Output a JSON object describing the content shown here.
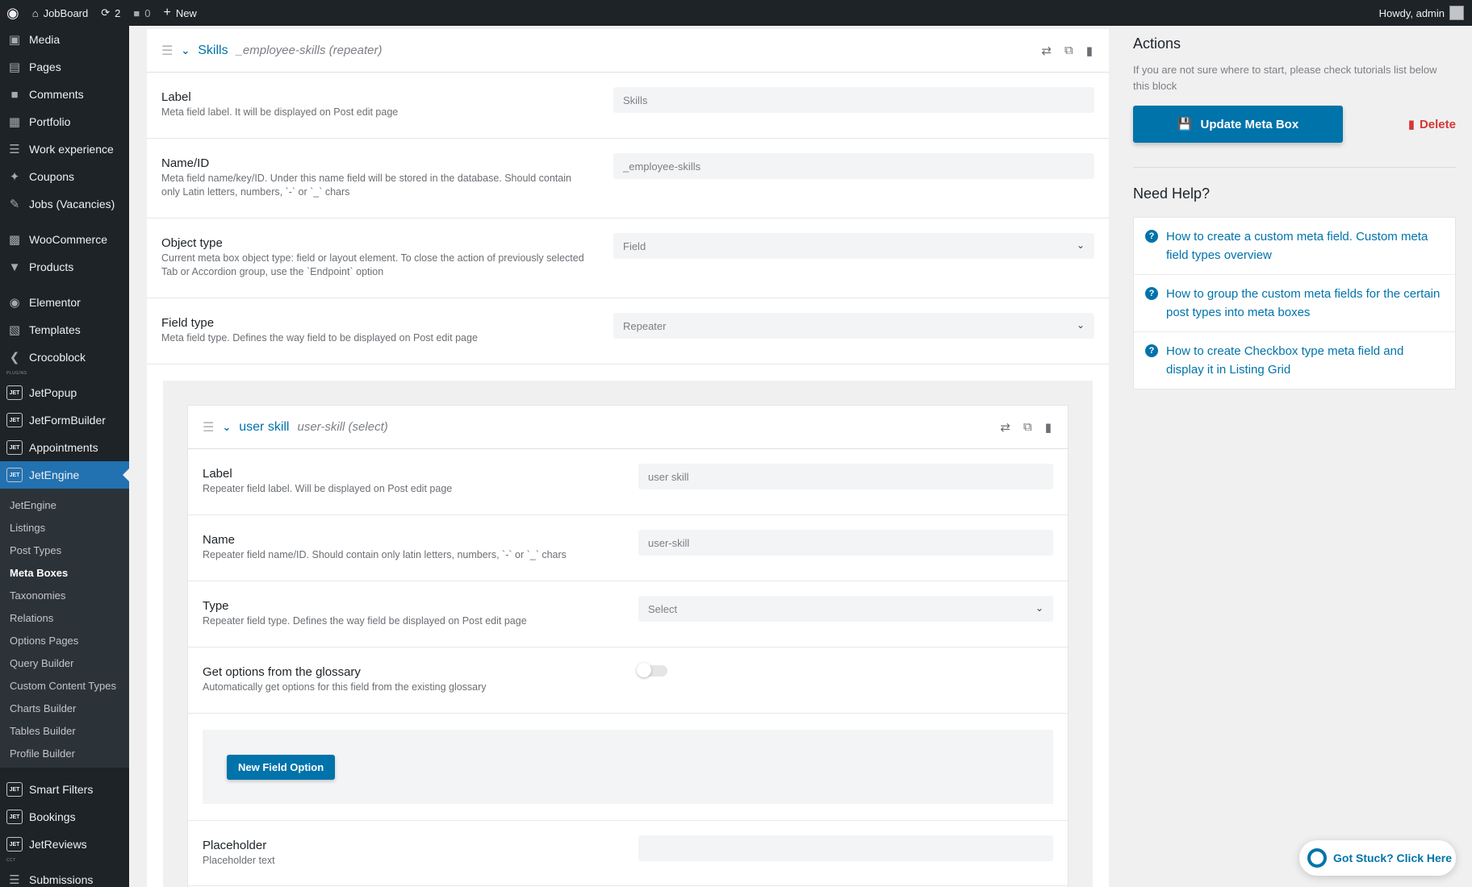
{
  "adminbar": {
    "site": "JobBoard",
    "updates": "2",
    "comments": "0",
    "new": "New",
    "howdy": "Howdy, admin"
  },
  "sidebar": {
    "top_items": [
      {
        "label": "Media",
        "icon": "media-icon"
      },
      {
        "label": "Pages",
        "icon": "pages-icon"
      },
      {
        "label": "Comments",
        "icon": "comments-icon"
      },
      {
        "label": "Portfolio",
        "icon": "portfolio-icon"
      },
      {
        "label": "Work experience",
        "icon": "list-icon"
      },
      {
        "label": "Coupons",
        "icon": "pin-icon"
      },
      {
        "label": "Jobs (Vacancies)",
        "icon": "edit-icon"
      }
    ],
    "woo_items": [
      {
        "label": "WooCommerce",
        "icon": "woo-icon"
      },
      {
        "label": "Products",
        "icon": "products-icon"
      }
    ],
    "builder_items": [
      {
        "label": "Elementor",
        "icon": "elementor-icon"
      },
      {
        "label": "Templates",
        "icon": "folder-icon"
      },
      {
        "label": "Crocoblock",
        "icon": "crocoblock-icon"
      }
    ],
    "plugins_tag": "PLUGINS",
    "jet_items": [
      {
        "label": "JetPopup"
      },
      {
        "label": "JetFormBuilder"
      },
      {
        "label": "Appointments"
      }
    ],
    "active_item": "JetEngine",
    "submenu": [
      "JetEngine",
      "Listings",
      "Post Types",
      "Meta Boxes",
      "Taxonomies",
      "Relations",
      "Options Pages",
      "Query Builder",
      "Custom Content Types",
      "Charts Builder",
      "Tables Builder",
      "Profile Builder"
    ],
    "submenu_current": "Meta Boxes",
    "bottom_items": [
      {
        "label": "Smart Filters"
      },
      {
        "label": "Bookings"
      },
      {
        "label": "JetReviews"
      }
    ],
    "cct_tag": "CCT",
    "cut_item": "Submissions"
  },
  "field": {
    "title": "Skills",
    "subtitle": "_employee-skills (repeater)",
    "rows": [
      {
        "label": "Label",
        "desc": "Meta field label. It will be displayed on Post edit page",
        "value": "Skills",
        "dropdown": false
      },
      {
        "label": "Name/ID",
        "desc": "Meta field name/key/ID. Under this name field will be stored in the database. Should contain only Latin letters, numbers, `-` or `_` chars",
        "value": "_employee-skills",
        "dropdown": false
      },
      {
        "label": "Object type",
        "desc": "Current meta box object type: field or layout element. To close the action of previously selected Tab or Accordion group, use the `Endpoint` option",
        "value": "Field",
        "dropdown": true
      },
      {
        "label": "Field type",
        "desc": "Meta field type. Defines the way field to be displayed on Post edit page",
        "value": "Repeater",
        "dropdown": true
      }
    ]
  },
  "repeater_field": {
    "title": "user skill",
    "subtitle": "user-skill (select)",
    "rows": [
      {
        "label": "Label",
        "desc": "Repeater field label. Will be displayed on Post edit page",
        "value": "user skill",
        "dropdown": false
      },
      {
        "label": "Name",
        "desc": "Repeater field name/ID. Should contain only latin letters, numbers, `-` or `_` chars",
        "value": "user-skill",
        "dropdown": false
      },
      {
        "label": "Type",
        "desc": "Repeater field type. Defines the way field be displayed on Post edit page",
        "value": "Select",
        "dropdown": true
      }
    ],
    "glossary": {
      "label": "Get options from the glossary",
      "desc": "Automatically get options for this field from the existing glossary",
      "enabled": false
    },
    "new_option_button": "New Field Option",
    "placeholder": {
      "label": "Placeholder",
      "desc": "Placeholder text",
      "value": ""
    }
  },
  "aside": {
    "actions_title": "Actions",
    "actions_note": "If you are not sure where to start, please check tutorials list below this block",
    "update_button": "Update Meta Box",
    "delete_button": "Delete",
    "help_title": "Need Help?",
    "help_links": [
      "How to create a custom meta field. Custom meta field types overview",
      "How to group the custom meta fields for the certain post types into meta boxes",
      "How to create Checkbox type meta field and display it in Listing Grid"
    ]
  },
  "stuck_button": "Got Stuck? Click Here",
  "colors": {
    "accent": "#0073aa",
    "admin_bg": "#1d2327",
    "active_menu": "#2271b1",
    "danger": "#d63638"
  }
}
